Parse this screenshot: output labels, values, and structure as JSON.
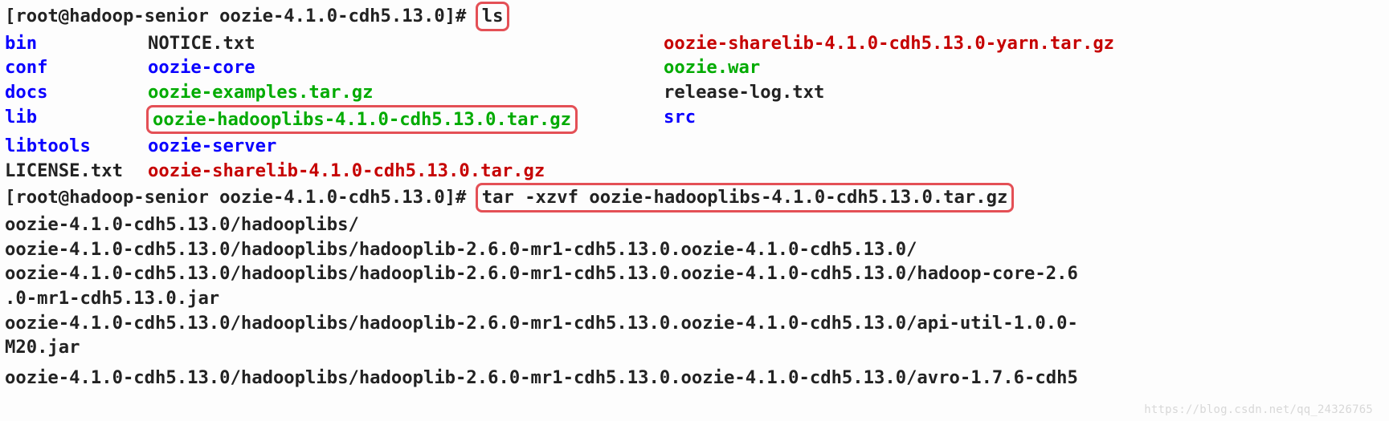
{
  "prompt1_prefix": "[root@hadoop-senior oozie-4.1.0-cdh5.13.0]# ",
  "cmd_ls": "ls",
  "ls": {
    "r0c0": "bin",
    "r0c1": "NOTICE.txt",
    "r0c2": "oozie-sharelib-4.1.0-cdh5.13.0-yarn.tar.gz",
    "r1c0": "conf",
    "r1c1": "oozie-core",
    "r1c2": "oozie.war",
    "r2c0": "docs",
    "r2c1": "oozie-examples.tar.gz",
    "r2c2": "release-log.txt",
    "r3c0": "lib",
    "r3c1": "oozie-hadooplibs-4.1.0-cdh5.13.0.tar.gz",
    "r3c2": "src",
    "r4c0": "libtools",
    "r4c1": "oozie-server",
    "r5c0": "LICENSE.txt",
    "r5c1": "oozie-sharelib-4.1.0-cdh5.13.0.tar.gz"
  },
  "prompt2_prefix": "[root@hadoop-senior oozie-4.1.0-cdh5.13.0]# ",
  "cmd_tar": "tar -xzvf oozie-hadooplibs-4.1.0-cdh5.13.0.tar.gz",
  "extract": {
    "l0": "oozie-4.1.0-cdh5.13.0/hadooplibs/",
    "l1": "oozie-4.1.0-cdh5.13.0/hadooplibs/hadooplib-2.6.0-mr1-cdh5.13.0.oozie-4.1.0-cdh5.13.0/",
    "l2a": "oozie-4.1.0-cdh5.13.0/hadooplibs/hadooplib-2.6.0-mr1-cdh5.13.0.oozie-4.1.0-cdh5.13.0/hadoop-core-2.6",
    "l2b": ".0-mr1-cdh5.13.0.jar",
    "l3a": "oozie-4.1.0-cdh5.13.0/hadooplibs/hadooplib-2.6.0-mr1-cdh5.13.0.oozie-4.1.0-cdh5.13.0/api-util-1.0.0-",
    "l3b": "M20.jar",
    "l4": "oozie-4.1.0-cdh5.13.0/hadooplibs/hadooplib-2.6.0-mr1-cdh5.13.0.oozie-4.1.0-cdh5.13.0/avro-1.7.6-cdh5"
  },
  "watermark": "https://blog.csdn.net/qq_24326765"
}
